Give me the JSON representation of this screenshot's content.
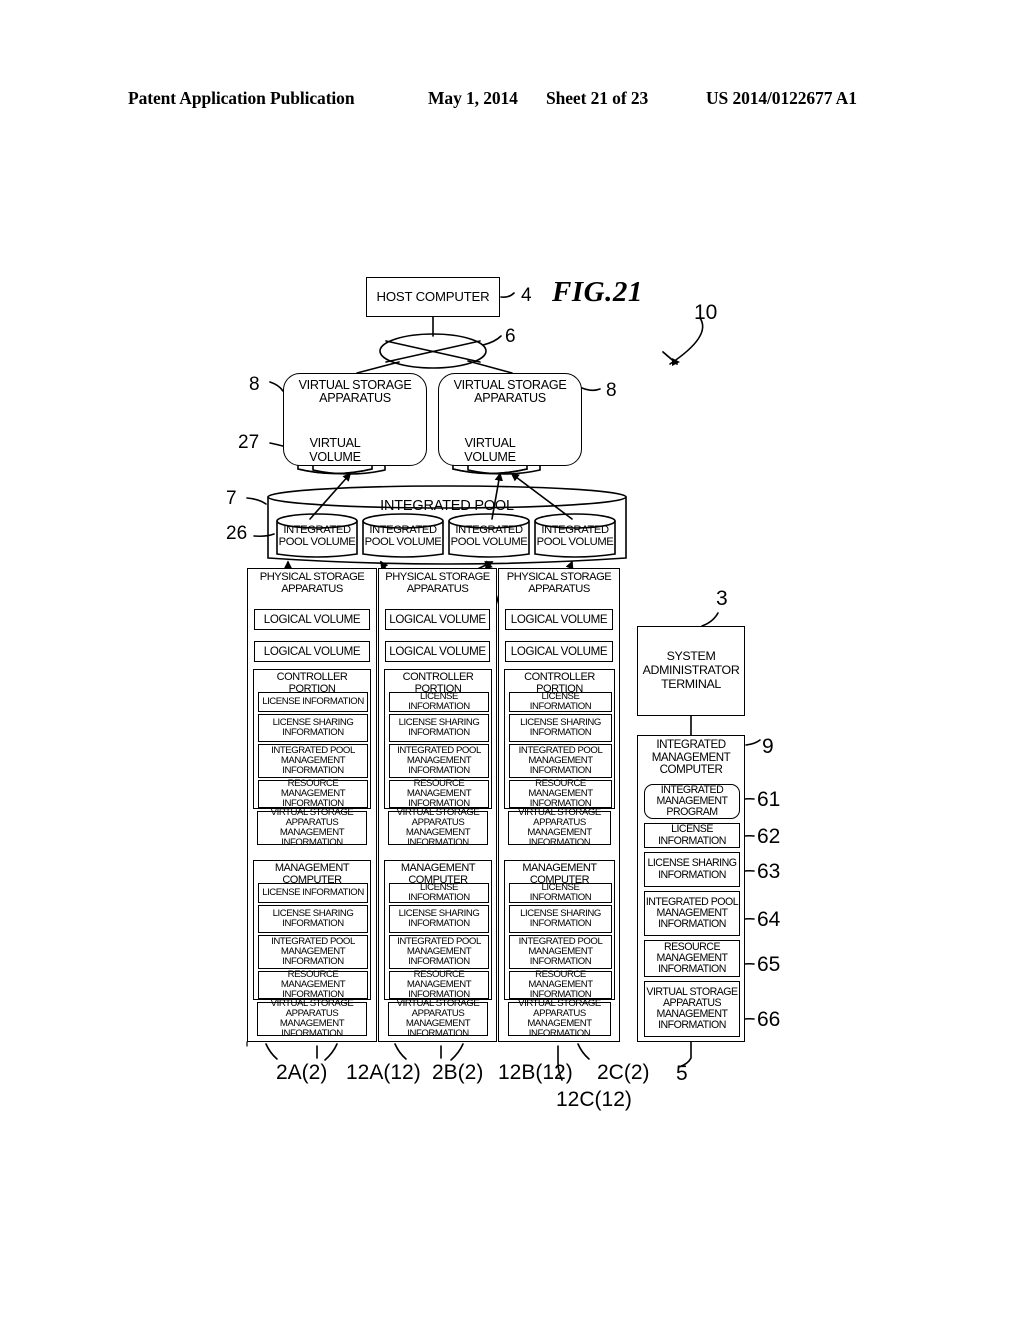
{
  "header": {
    "publication": "Patent Application Publication",
    "date": "May 1, 2014",
    "sheet": "Sheet 21 of 23",
    "number": "US 2014/0122677 A1"
  },
  "figure": {
    "title": "FIG.21",
    "system_ref": "10",
    "host_computer": {
      "label": "HOST COMPUTER",
      "ref": "4"
    },
    "network": {
      "name": "network-cloud",
      "ref": "6"
    },
    "virtual_storage_apparatus": [
      {
        "label": "VIRTUAL STORAGE APPARATUS",
        "ref": "8",
        "volume": {
          "label": "VIRTUAL VOLUME",
          "ref": "27"
        }
      },
      {
        "label": "VIRTUAL STORAGE APPARATUS",
        "ref": "8",
        "volume": {
          "label": "VIRTUAL VOLUME",
          "ref": ""
        }
      }
    ],
    "integrated_pool": {
      "label": "INTEGRATED POOL",
      "ref": "7",
      "volume_ref": "26",
      "volumes": [
        "INTEGRATED POOL VOLUME",
        "INTEGRATED POOL VOLUME",
        "INTEGRATED POOL VOLUME",
        "INTEGRATED POOL VOLUME"
      ]
    },
    "physical_storage_apparatus": [
      {
        "label": "PHYSICAL STORAGE APPARATUS",
        "ref": "2A(2)",
        "logical_volumes": [
          "LOGICAL VOLUME",
          "LOGICAL VOLUME"
        ],
        "controller_portion": {
          "label": "CONTROLLER PORTION",
          "items": [
            "LICENSE INFORMATION",
            "LICENSE SHARING INFORMATION",
            "INTEGRATED POOL MANAGEMENT INFORMATION",
            "RESOURCE MANAGEMENT INFORMATION",
            "VIRTUAL STORAGE APPARATUS MANAGEMENT INFORMATION"
          ]
        },
        "management_computer": {
          "label": "MANAGEMENT COMPUTER",
          "ref": "12A(12)",
          "items": [
            "LICENSE INFORMATION",
            "LICENSE SHARING INFORMATION",
            "INTEGRATED POOL MANAGEMENT INFORMATION",
            "RESOURCE MANAGEMENT INFORMATION",
            "VIRTUAL STORAGE APPARATUS MANAGEMENT INFORMATION"
          ]
        }
      },
      {
        "label": "PHYSICAL STORAGE APPARATUS",
        "ref": "2B(2)",
        "logical_volumes": [
          "LOGICAL VOLUME",
          "LOGICAL VOLUME"
        ],
        "controller_portion": {
          "label": "CONTROLLER PORTION",
          "items": [
            "LICENSE INFORMATION",
            "LICENSE SHARING INFORMATION",
            "INTEGRATED POOL MANAGEMENT INFORMATION",
            "RESOURCE MANAGEMENT INFORMATION",
            "VIRTUAL STORAGE APPARATUS MANAGEMENT INFORMATION"
          ]
        },
        "management_computer": {
          "label": "MANAGEMENT COMPUTER",
          "ref": "12B(12)",
          "items": [
            "LICENSE INFORMATION",
            "LICENSE SHARING INFORMATION",
            "INTEGRATED POOL MANAGEMENT INFORMATION",
            "RESOURCE MANAGEMENT INFORMATION",
            "VIRTUAL STORAGE APPARATUS MANAGEMENT INFORMATION"
          ]
        }
      },
      {
        "label": "PHYSICAL STORAGE APPARATUS",
        "ref": "2C(2)",
        "logical_volumes": [
          "LOGICAL VOLUME",
          "LOGICAL VOLUME"
        ],
        "controller_portion": {
          "label": "CONTROLLER PORTION",
          "items": [
            "LICENSE INFORMATION",
            "LICENSE SHARING INFORMATION",
            "INTEGRATED POOL MANAGEMENT INFORMATION",
            "RESOURCE MANAGEMENT INFORMATION",
            "VIRTUAL STORAGE APPARATUS MANAGEMENT INFORMATION"
          ]
        },
        "management_computer": {
          "label": "MANAGEMENT COMPUTER",
          "ref": "12C(12)",
          "items": [
            "LICENSE INFORMATION",
            "LICENSE SHARING INFORMATION",
            "INTEGRATED POOL MANAGEMENT INFORMATION",
            "RESOURCE MANAGEMENT INFORMATION",
            "VIRTUAL STORAGE APPARATUS MANAGEMENT INFORMATION"
          ]
        }
      }
    ],
    "system_administrator_terminal": {
      "label": "SYSTEM ADMINISTRATOR TERMINAL",
      "ref": "3"
    },
    "integrated_management_computer": {
      "label": "INTEGRATED MANAGEMENT COMPUTER",
      "ref": "9",
      "group_ref": "5",
      "items": [
        {
          "label": "INTEGRATED MANAGEMENT PROGRAM",
          "ref": "61"
        },
        {
          "label": "LICENSE INFORMATION",
          "ref": "62"
        },
        {
          "label": "LICENSE SHARING INFORMATION",
          "ref": "63"
        },
        {
          "label": "INTEGRATED POOL MANAGEMENT INFORMATION",
          "ref": "64"
        },
        {
          "label": "RESOURCE MANAGEMENT INFORMATION",
          "ref": "65"
        },
        {
          "label": "VIRTUAL STORAGE APPARATUS MANAGEMENT INFORMATION",
          "ref": "66"
        }
      ]
    }
  },
  "colors": {
    "ink": "#000000",
    "paper": "#ffffff"
  }
}
